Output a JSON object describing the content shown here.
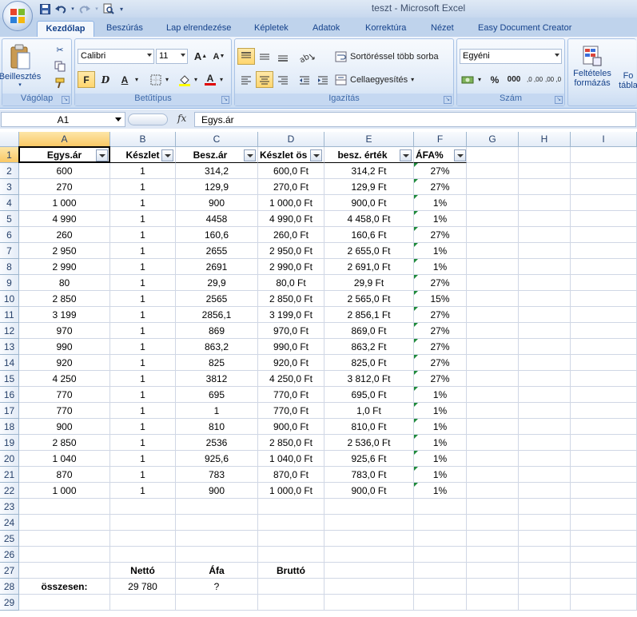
{
  "window": {
    "title": "teszt - Microsoft Excel"
  },
  "qat": {
    "save_icon": "save-icon",
    "undo_icon": "undo-icon",
    "redo_icon": "redo-icon",
    "preview_icon": "print-preview-icon"
  },
  "tabs": [
    "Kezdőlap",
    "Beszúrás",
    "Lap elrendezése",
    "Képletek",
    "Adatok",
    "Korrektúra",
    "Nézet",
    "Easy Document Creator"
  ],
  "ribbon": {
    "clipboard": {
      "label": "Vágólap",
      "paste_label": "Beillesztés"
    },
    "font": {
      "label": "Betűtípus",
      "font_name": "Calibri",
      "font_size": "11",
      "bold": "F",
      "italic": "D",
      "underline": "A",
      "grow": "A",
      "shrink": "A",
      "font_color": "A"
    },
    "alignment": {
      "label": "Igazítás",
      "wrap": "Sortöréssel több sorba",
      "merge": "Cellaegyesítés"
    },
    "number": {
      "label": "Szám",
      "format": "Egyéni",
      "percent": "%",
      "thousands": "000",
      "inc_decimal": ",0 ,00",
      "dec_decimal": ",00 ,0"
    },
    "styles": {
      "conditional": "Feltételes",
      "conditional2": "formázás",
      "table": "Fo",
      "table2": "tábla"
    }
  },
  "formula_bar": {
    "name_box": "A1",
    "fx": "fx",
    "value": "Egys.ár"
  },
  "columns": [
    "A",
    "B",
    "C",
    "D",
    "E",
    "F",
    "G",
    "H",
    "I"
  ],
  "headers": [
    "Egys.ár",
    "Készlet",
    "Besz.ár",
    "Készlet ös",
    "besz. érték",
    "ÁFA%"
  ],
  "rows": [
    [
      "600",
      "1",
      "314,2",
      "600,0 Ft",
      "314,2 Ft",
      "27%"
    ],
    [
      "270",
      "1",
      "129,9",
      "270,0 Ft",
      "129,9 Ft",
      "27%"
    ],
    [
      "1 000",
      "1",
      "900",
      "1 000,0 Ft",
      "900,0 Ft",
      "1%"
    ],
    [
      "4 990",
      "1",
      "4458",
      "4 990,0 Ft",
      "4 458,0 Ft",
      "1%"
    ],
    [
      "260",
      "1",
      "160,6",
      "260,0 Ft",
      "160,6 Ft",
      "27%"
    ],
    [
      "2 950",
      "1",
      "2655",
      "2 950,0 Ft",
      "2 655,0 Ft",
      "1%"
    ],
    [
      "2 990",
      "1",
      "2691",
      "2 990,0 Ft",
      "2 691,0 Ft",
      "1%"
    ],
    [
      "80",
      "1",
      "29,9",
      "80,0 Ft",
      "29,9 Ft",
      "27%"
    ],
    [
      "2 850",
      "1",
      "2565",
      "2 850,0 Ft",
      "2 565,0 Ft",
      "15%"
    ],
    [
      "3 199",
      "1",
      "2856,1",
      "3 199,0 Ft",
      "2 856,1 Ft",
      "27%"
    ],
    [
      "970",
      "1",
      "869",
      "970,0 Ft",
      "869,0 Ft",
      "27%"
    ],
    [
      "990",
      "1",
      "863,2",
      "990,0 Ft",
      "863,2 Ft",
      "27%"
    ],
    [
      "920",
      "1",
      "825",
      "920,0 Ft",
      "825,0 Ft",
      "27%"
    ],
    [
      "4 250",
      "1",
      "3812",
      "4 250,0 Ft",
      "3 812,0 Ft",
      "27%"
    ],
    [
      "770",
      "1",
      "695",
      "770,0 Ft",
      "695,0 Ft",
      "1%"
    ],
    [
      "770",
      "1",
      "1",
      "770,0 Ft",
      "1,0 Ft",
      "1%"
    ],
    [
      "900",
      "1",
      "810",
      "900,0 Ft",
      "810,0 Ft",
      "1%"
    ],
    [
      "2 850",
      "1",
      "2536",
      "2 850,0 Ft",
      "2 536,0 Ft",
      "1%"
    ],
    [
      "1 040",
      "1",
      "925,6",
      "1 040,0 Ft",
      "925,6 Ft",
      "1%"
    ],
    [
      "870",
      "1",
      "783",
      "870,0 Ft",
      "783,0 Ft",
      "1%"
    ],
    [
      "1 000",
      "1",
      "900",
      "1 000,0 Ft",
      "900,0 Ft",
      "1%"
    ]
  ],
  "row_numbers": [
    "1",
    "2",
    "3",
    "4",
    "5",
    "6",
    "7",
    "8",
    "9",
    "10",
    "11",
    "12",
    "13",
    "14",
    "15",
    "16",
    "17",
    "18",
    "19",
    "20",
    "21",
    "22",
    "23",
    "24",
    "25",
    "26",
    "27",
    "28",
    "29"
  ],
  "summary": {
    "netto_label": "Nettó",
    "afa_label": "Áfa",
    "brutto_label": "Bruttó",
    "total_label": "összesen:",
    "netto_value": "29 780",
    "afa_value": "?"
  }
}
